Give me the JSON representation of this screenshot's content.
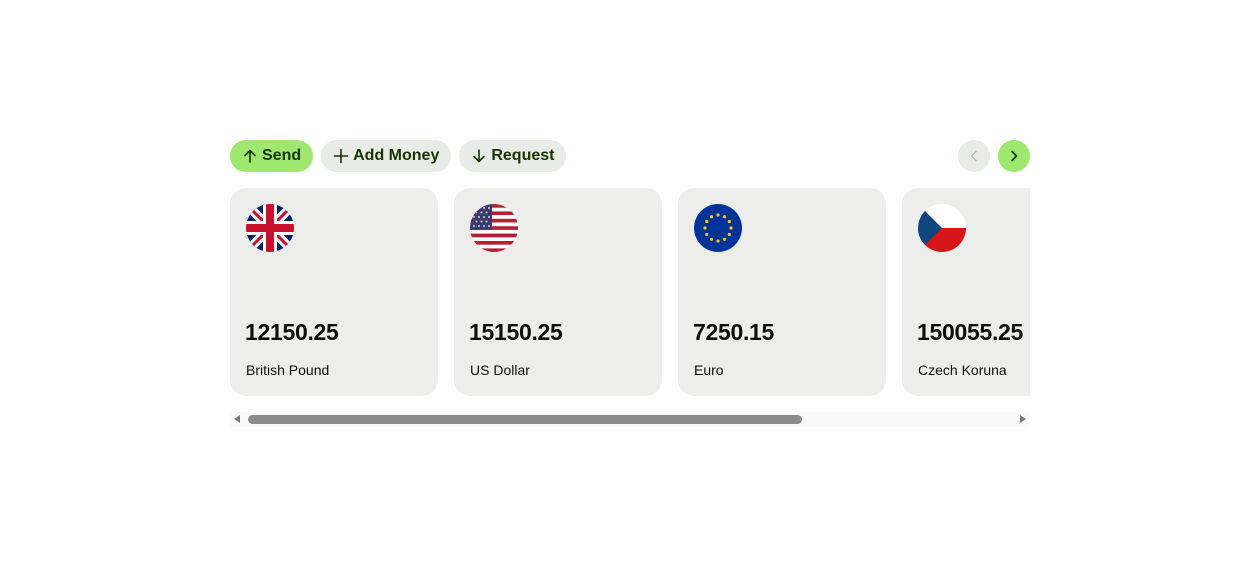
{
  "actions": {
    "send_label": "Send",
    "add_money_label": "Add Money",
    "request_label": "Request"
  },
  "colors": {
    "accent": "#9fe870",
    "pill_bg": "#e8ebe6",
    "card_bg": "#edeeec",
    "text": "#0e0f0c",
    "button_text": "#163300"
  },
  "icons": {
    "send": "arrow-up-icon",
    "add_money": "plus-icon",
    "request": "arrow-down-icon",
    "prev": "chevron-left-icon",
    "next": "chevron-right-icon"
  },
  "accounts": [
    {
      "amount": "12150.25",
      "currency": "British Pound",
      "flag": "uk-flag-icon"
    },
    {
      "amount": "15150.25",
      "currency": "US Dollar",
      "flag": "us-flag-icon"
    },
    {
      "amount": "7250.15",
      "currency": "Euro",
      "flag": "eu-flag-icon"
    },
    {
      "amount": "150055.25",
      "currency": "Czech Koruna",
      "flag": "cz-flag-icon"
    }
  ],
  "navigation": {
    "prev_enabled": false,
    "next_enabled": true
  }
}
